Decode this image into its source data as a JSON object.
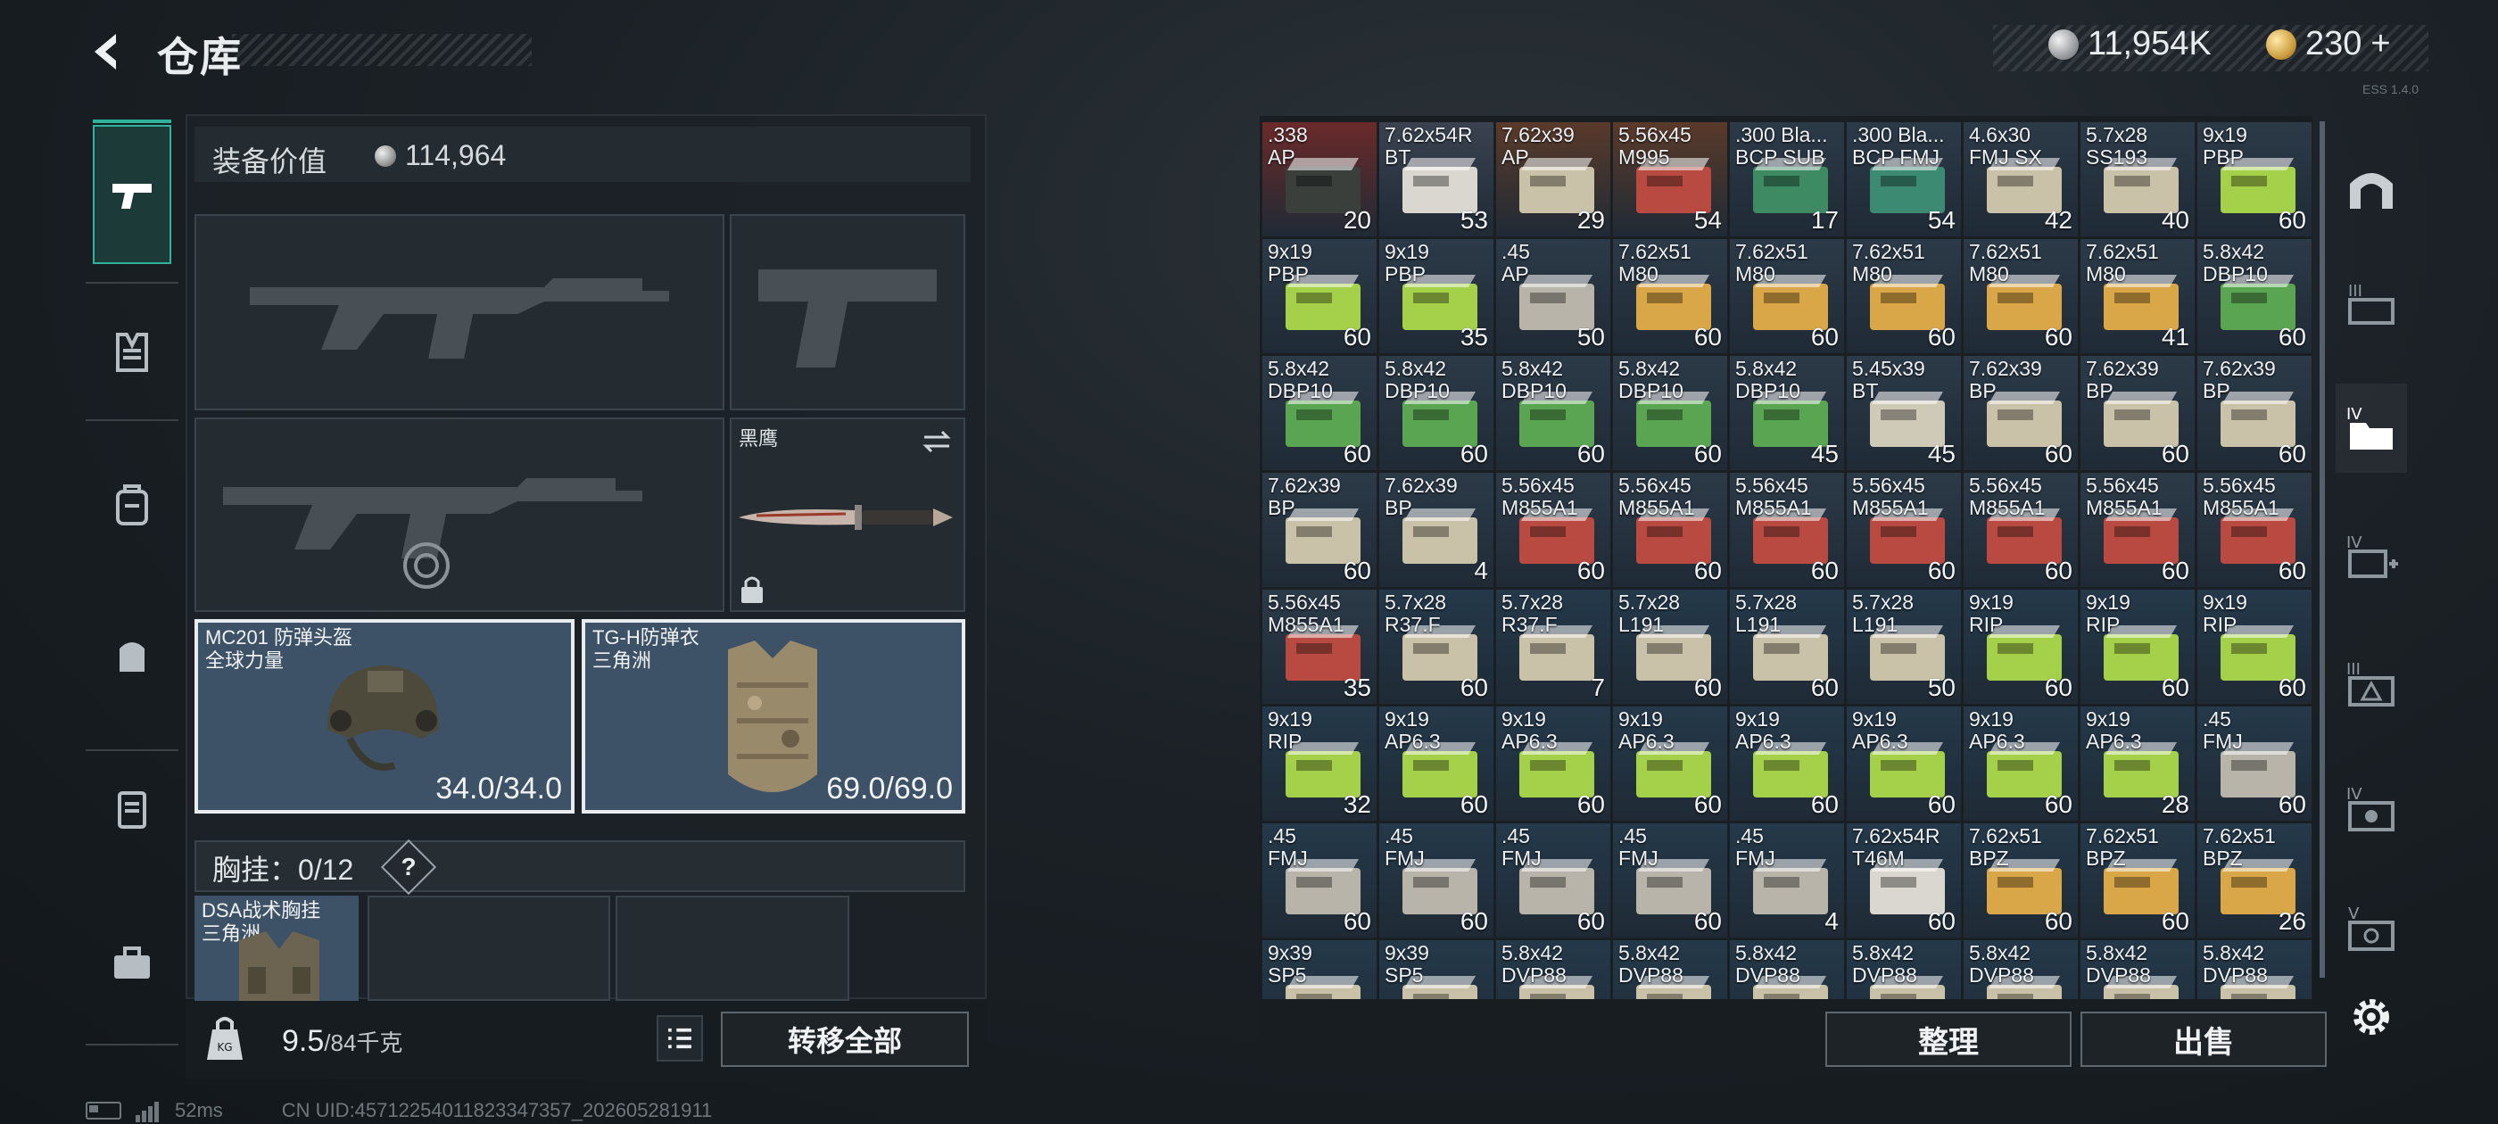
{
  "header": {
    "title": "仓库",
    "silver": "11,954K",
    "gold": "230",
    "gold_plus": "+",
    "version": "ESS 1.4.0"
  },
  "left_tabs": [
    "pistol-icon",
    "vest-icon",
    "backpack-icon",
    "pouch-icon",
    "case-icon",
    "toolbox-icon"
  ],
  "equipment": {
    "value_label": "装备价值",
    "value": "114,964",
    "knife_label": "黑鹰",
    "helmet": {
      "name": "MC201 防弹头盔",
      "sub": "全球力量",
      "durability": "34.0/34.0"
    },
    "armor": {
      "name": "TG-H防弹衣",
      "sub": "三角洲",
      "durability": "69.0/69.0"
    },
    "chest_label": "胸挂：",
    "chest_count": "0/12",
    "chest_help": "?",
    "rig": {
      "name": "DSA战术胸挂",
      "sub": "三角洲"
    }
  },
  "weight": {
    "current": "9.5",
    "max": "/84千克"
  },
  "buttons": {
    "transfer_all": "转移全部",
    "sort": "整理",
    "sell": "出售"
  },
  "status": {
    "ping": "52ms",
    "uid": "CN UID:4571225401182334735​7_202605281911"
  },
  "stash": {
    "items": [
      {
        "n": ".338\nAP",
        "q": "20",
        "c": "#6b2a2a",
        "b": "#3a3f3c"
      },
      {
        "n": "7.62x54R\nBT",
        "q": "53",
        "c": "#3a4250",
        "b": "#d9d7cf"
      },
      {
        "n": "7.62x39\nAP",
        "q": "29",
        "c": "#5a3a2a",
        "b": "#c9c1a8"
      },
      {
        "n": "5.56x45\nM995",
        "q": "54",
        "c": "#5a3a2a",
        "b": "#b84a42"
      },
      {
        "n": ".300 Bla...\nBCP SUB",
        "q": "17",
        "c": "#2c3a48",
        "b": "#3d8a63"
      },
      {
        "n": ".300 Bla...\nBCP FMJ",
        "q": "54",
        "c": "#2c3a48",
        "b": "#3d8a73"
      },
      {
        "n": "4.6x30\nFMJ SX",
        "q": "42",
        "c": "#2c3a48",
        "b": "#c9c1a8"
      },
      {
        "n": "5.7x28\nSS193",
        "q": "40",
        "c": "#2c3a48",
        "b": "#c9c1a8"
      },
      {
        "n": "9x19\nPBP",
        "q": "60",
        "c": "#2c3a48",
        "b": "#a5d04a"
      },
      {
        "n": "9x19\nPBP",
        "q": "60",
        "c": "#2c3a48",
        "b": "#a5d04a"
      },
      {
        "n": "9x19\nPBP",
        "q": "35",
        "c": "#2c3a48",
        "b": "#a5d04a"
      },
      {
        "n": ".45\nAP",
        "q": "50",
        "c": "#2c3a48",
        "b": "#b8b4aa"
      },
      {
        "n": "7.62x51\nM80",
        "q": "60",
        "c": "#2c3a48",
        "b": "#d9a648"
      },
      {
        "n": "7.62x51\nM80",
        "q": "60",
        "c": "#2c3a48",
        "b": "#d9a648"
      },
      {
        "n": "7.62x51\nM80",
        "q": "60",
        "c": "#2c3a48",
        "b": "#d9a648"
      },
      {
        "n": "7.62x51\nM80",
        "q": "60",
        "c": "#2c3a48",
        "b": "#d9a648"
      },
      {
        "n": "7.62x51\nM80",
        "q": "41",
        "c": "#2c3a48",
        "b": "#d9a648"
      },
      {
        "n": "5.8x42\nDBP10",
        "q": "60",
        "c": "#2c3a48",
        "b": "#5aa552"
      },
      {
        "n": "5.8x42\nDBP10",
        "q": "60",
        "c": "#2c3a48",
        "b": "#5aa552"
      },
      {
        "n": "5.8x42\nDBP10",
        "q": "60",
        "c": "#2c3a48",
        "b": "#5aa552"
      },
      {
        "n": "5.8x42\nDBP10",
        "q": "60",
        "c": "#2c3a48",
        "b": "#5aa552"
      },
      {
        "n": "5.8x42\nDBP10",
        "q": "60",
        "c": "#2c3a48",
        "b": "#5aa552"
      },
      {
        "n": "5.8x42\nDBP10",
        "q": "45",
        "c": "#2c3a48",
        "b": "#5aa552"
      },
      {
        "n": "5.45x39\nBT",
        "q": "45",
        "c": "#2c3a48",
        "b": "#cfc9b8"
      },
      {
        "n": "7.62x39\nBP",
        "q": "60",
        "c": "#2c3a48",
        "b": "#c9c1a8"
      },
      {
        "n": "7.62x39\nBP",
        "q": "60",
        "c": "#2c3a48",
        "b": "#c9c1a8"
      },
      {
        "n": "7.62x39\nBP",
        "q": "60",
        "c": "#2c3a48",
        "b": "#c9c1a8"
      },
      {
        "n": "7.62x39\nBP",
        "q": "60",
        "c": "#2c3a48",
        "b": "#c9c1a8"
      },
      {
        "n": "7.62x39\nBP",
        "q": "4",
        "c": "#2c3a48",
        "b": "#c9c1a8"
      },
      {
        "n": "5.56x45\nM855A1",
        "q": "60",
        "c": "#2c3a48",
        "b": "#b84a42"
      },
      {
        "n": "5.56x45\nM855A1",
        "q": "60",
        "c": "#2c3a48",
        "b": "#b84a42"
      },
      {
        "n": "5.56x45\nM855A1",
        "q": "60",
        "c": "#2c3a48",
        "b": "#b84a42"
      },
      {
        "n": "5.56x45\nM855A1",
        "q": "60",
        "c": "#2c3a48",
        "b": "#b84a42"
      },
      {
        "n": "5.56x45\nM855A1",
        "q": "60",
        "c": "#2c3a48",
        "b": "#b84a42"
      },
      {
        "n": "5.56x45\nM855A1",
        "q": "60",
        "c": "#2c3a48",
        "b": "#b84a42"
      },
      {
        "n": "5.56x45\nM855A1",
        "q": "60",
        "c": "#2c3a48",
        "b": "#b84a42"
      },
      {
        "n": "5.56x45\nM855A1",
        "q": "35",
        "c": "#2c3a48",
        "b": "#b84a42"
      },
      {
        "n": "5.7x28\nR37.F",
        "q": "60",
        "c": "#24394a",
        "b": "#c9c1a8"
      },
      {
        "n": "5.7x28\nR37.F",
        "q": "7",
        "c": "#24394a",
        "b": "#c9c1a8"
      },
      {
        "n": "5.7x28\nL191",
        "q": "60",
        "c": "#24394a",
        "b": "#c9c1a8"
      },
      {
        "n": "5.7x28\nL191",
        "q": "60",
        "c": "#24394a",
        "b": "#c9c1a8"
      },
      {
        "n": "5.7x28\nL191",
        "q": "50",
        "c": "#24394a",
        "b": "#c9c1a8"
      },
      {
        "n": "9x19\nRIP",
        "q": "60",
        "c": "#24394a",
        "b": "#a5d04a"
      },
      {
        "n": "9x19\nRIP",
        "q": "60",
        "c": "#24394a",
        "b": "#a5d04a"
      },
      {
        "n": "9x19\nRIP",
        "q": "60",
        "c": "#24394a",
        "b": "#a5d04a"
      },
      {
        "n": "9x19\nRIP",
        "q": "32",
        "c": "#24394a",
        "b": "#a5d04a"
      },
      {
        "n": "9x19\nAP6.3",
        "q": "60",
        "c": "#24394a",
        "b": "#a5d04a"
      },
      {
        "n": "9x19\nAP6.3",
        "q": "60",
        "c": "#24394a",
        "b": "#a5d04a"
      },
      {
        "n": "9x19\nAP6.3",
        "q": "60",
        "c": "#24394a",
        "b": "#a5d04a"
      },
      {
        "n": "9x19\nAP6.3",
        "q": "60",
        "c": "#24394a",
        "b": "#a5d04a"
      },
      {
        "n": "9x19\nAP6.3",
        "q": "60",
        "c": "#24394a",
        "b": "#a5d04a"
      },
      {
        "n": "9x19\nAP6.3",
        "q": "60",
        "c": "#24394a",
        "b": "#a5d04a"
      },
      {
        "n": "9x19\nAP6.3",
        "q": "28",
        "c": "#24394a",
        "b": "#a5d04a"
      },
      {
        "n": ".45\nFMJ",
        "q": "60",
        "c": "#24394a",
        "b": "#b8b4aa"
      },
      {
        "n": ".45\nFMJ",
        "q": "60",
        "c": "#24394a",
        "b": "#b8b4aa"
      },
      {
        "n": ".45\nFMJ",
        "q": "60",
        "c": "#24394a",
        "b": "#b8b4aa"
      },
      {
        "n": ".45\nFMJ",
        "q": "60",
        "c": "#24394a",
        "b": "#b8b4aa"
      },
      {
        "n": ".45\nFMJ",
        "q": "60",
        "c": "#24394a",
        "b": "#b8b4aa"
      },
      {
        "n": ".45\nFMJ",
        "q": "4",
        "c": "#24394a",
        "b": "#b8b4aa"
      },
      {
        "n": "7.62x54R\nT46M",
        "q": "60",
        "c": "#24394a",
        "b": "#d9d7cf"
      },
      {
        "n": "7.62x51\nBPZ",
        "q": "60",
        "c": "#24394a",
        "b": "#d9a648"
      },
      {
        "n": "7.62x51\nBPZ",
        "q": "60",
        "c": "#24394a",
        "b": "#d9a648"
      },
      {
        "n": "7.62x51\nBPZ",
        "q": "26",
        "c": "#24394a",
        "b": "#d9a648"
      },
      {
        "n": "9x39\nSP5",
        "q": "",
        "c": "#24394a",
        "b": "#c9c1a8"
      },
      {
        "n": "9x39\nSP5",
        "q": "",
        "c": "#24394a",
        "b": "#c9c1a8"
      },
      {
        "n": "5.8x42\nDVP88",
        "q": "",
        "c": "#24394a",
        "b": "#c9c1a8"
      },
      {
        "n": "5.8x42\nDVP88",
        "q": "",
        "c": "#24394a",
        "b": "#c9c1a8"
      },
      {
        "n": "5.8x42\nDVP88",
        "q": "",
        "c": "#24394a",
        "b": "#c9c1a8"
      },
      {
        "n": "5.8x42\nDVP88",
        "q": "",
        "c": "#24394a",
        "b": "#c9c1a8"
      },
      {
        "n": "5.8x42\nDVP88",
        "q": "",
        "c": "#24394a",
        "b": "#c9c1a8"
      },
      {
        "n": "5.8x42\nDVP88",
        "q": "",
        "c": "#24394a",
        "b": "#c9c1a8"
      },
      {
        "n": "5.8x42\nDVP88",
        "q": "",
        "c": "#24394a",
        "b": "#c9c1a8"
      }
    ]
  },
  "right_tabs": [
    {
      "icon": "stash-arch-icon",
      "level": ""
    },
    {
      "icon": "container-icon",
      "level": "III"
    },
    {
      "icon": "folder-container-icon",
      "level": "IV"
    },
    {
      "icon": "medkit-container-icon",
      "level": "IV"
    },
    {
      "icon": "warning-container-icon",
      "level": "III"
    },
    {
      "icon": "gear-box-icon",
      "level": "IV"
    },
    {
      "icon": "tools-box-icon",
      "level": "V"
    }
  ]
}
